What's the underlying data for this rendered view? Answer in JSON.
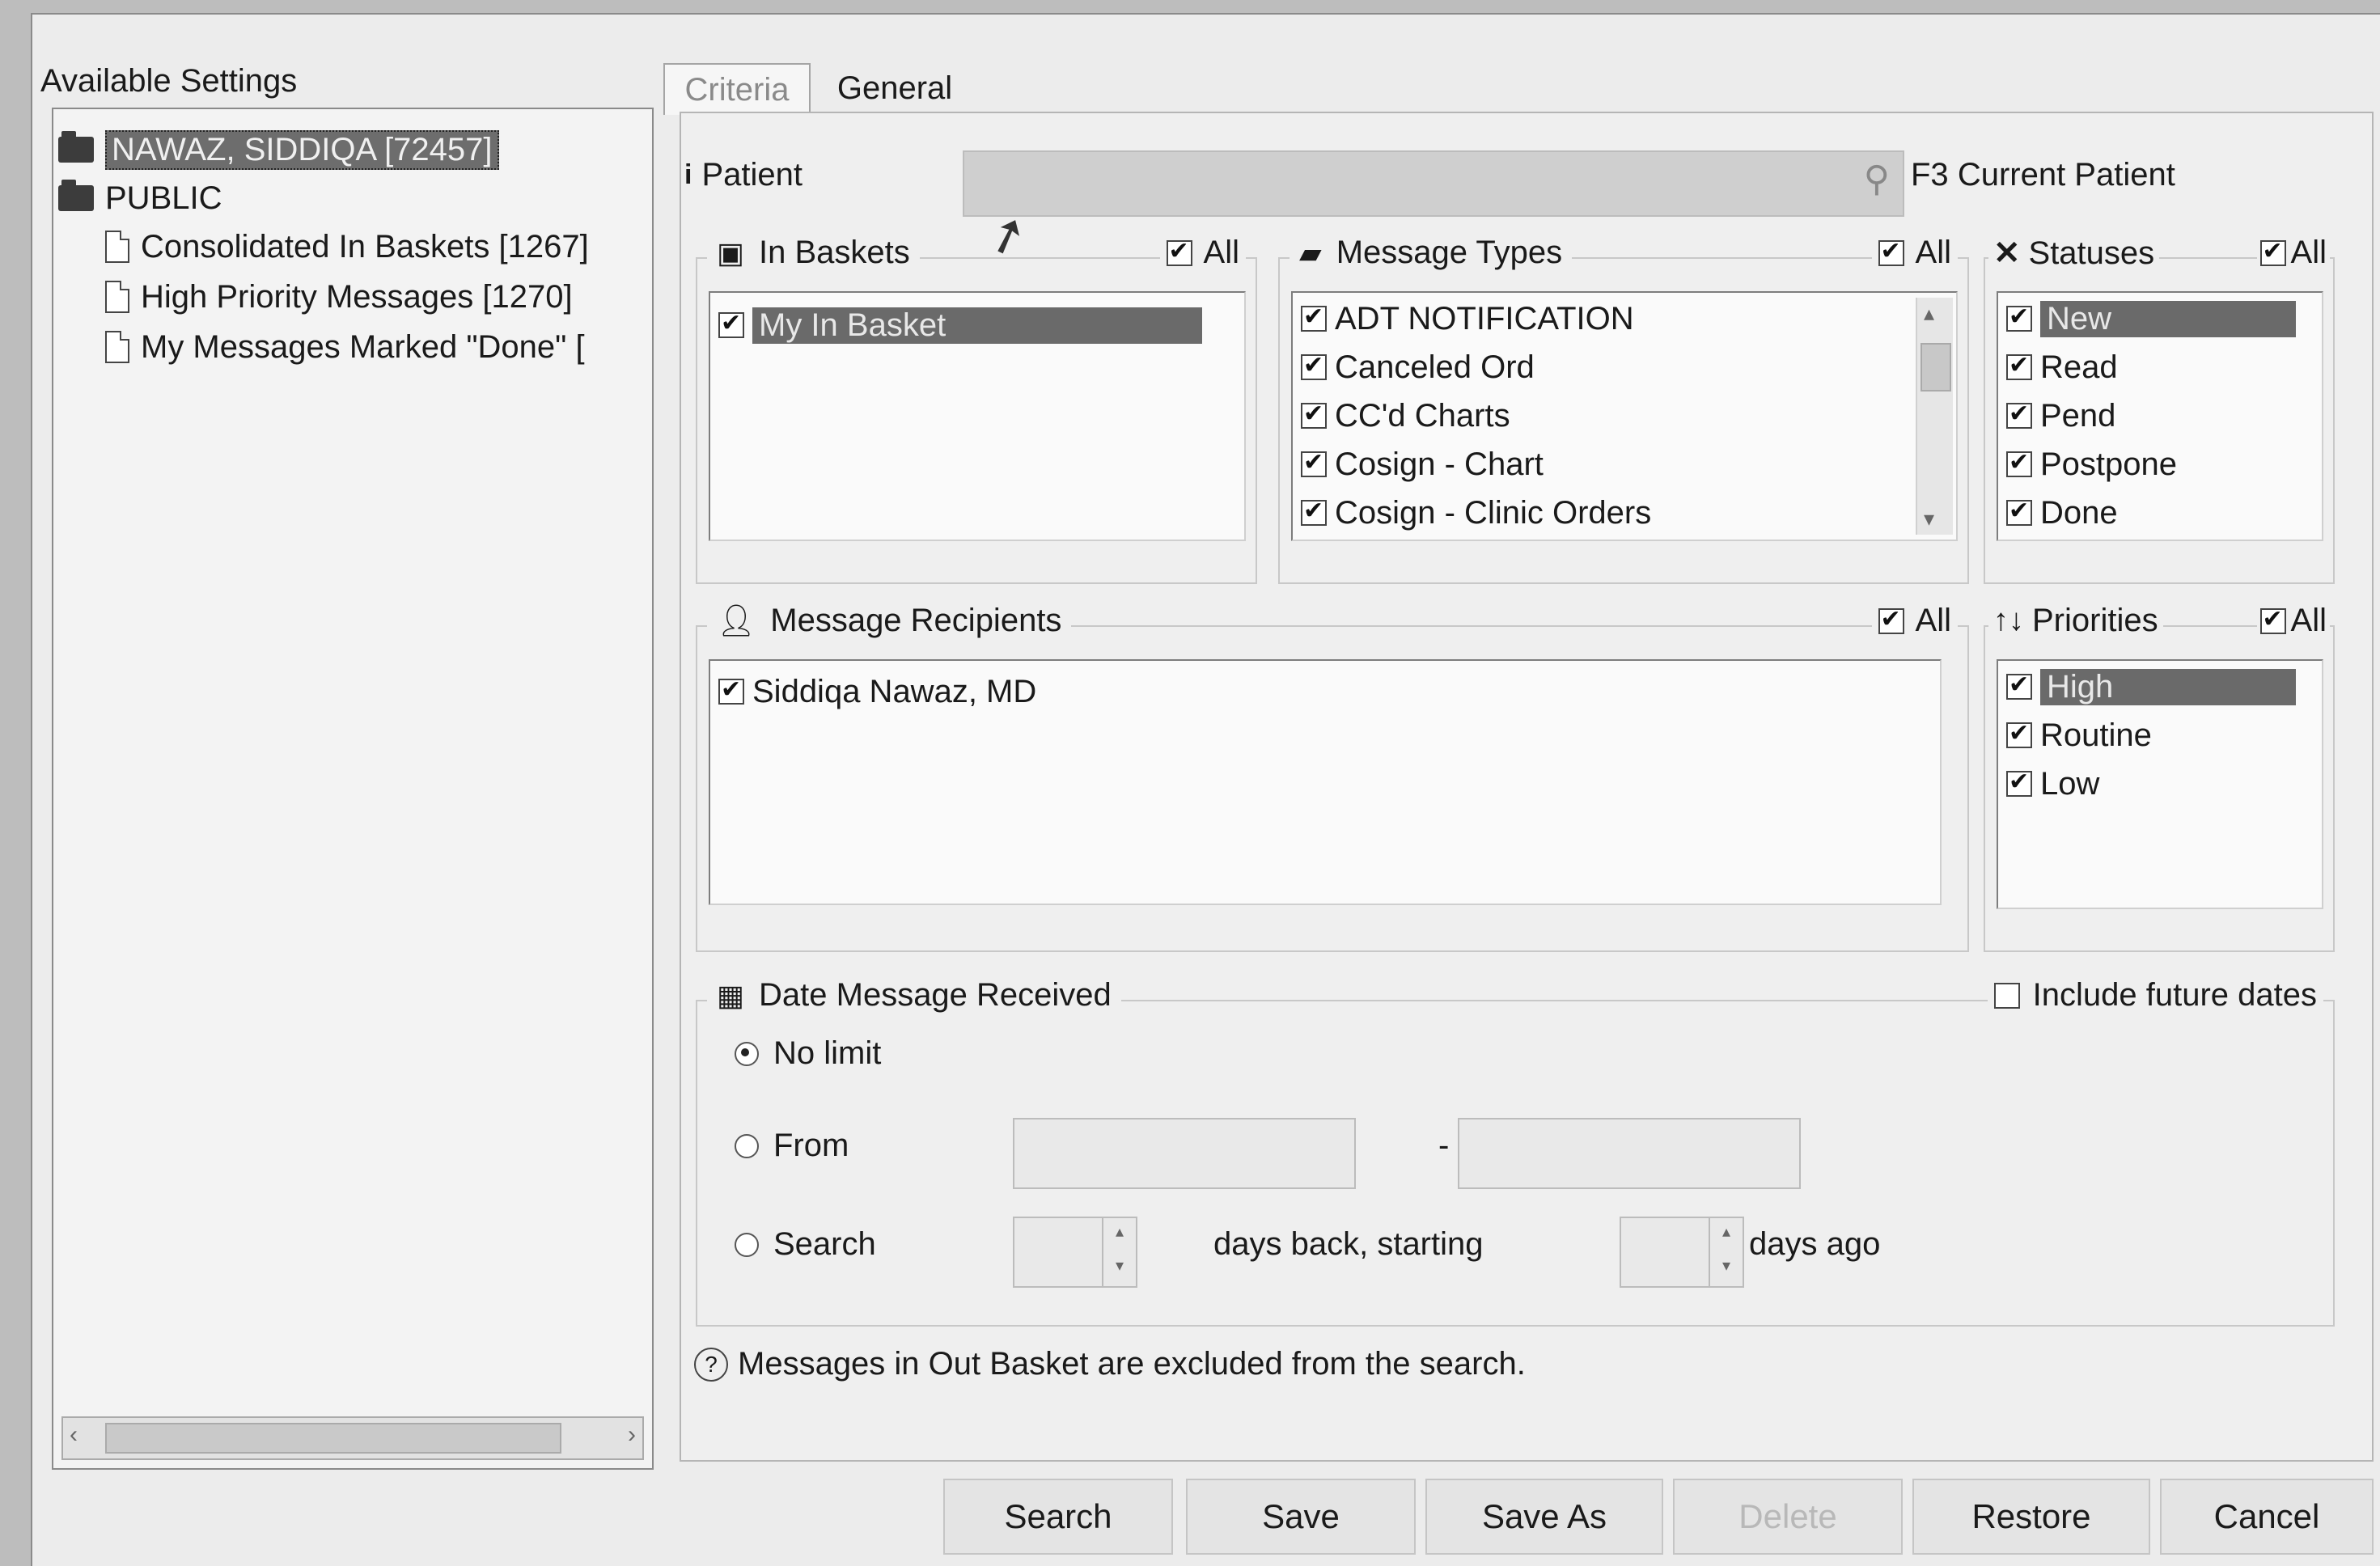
{
  "sidebar": {
    "title": "Available Settings",
    "user_node": "NAWAZ, SIDDIQA [72457]",
    "public_node": "PUBLIC",
    "items": [
      {
        "label": "Consolidated In Baskets [1267]"
      },
      {
        "label": "High Priority Messages [1270]"
      },
      {
        "label": "My Messages Marked \"Done\" ["
      }
    ]
  },
  "tabs": [
    {
      "label": "Criteria"
    },
    {
      "label": "General"
    }
  ],
  "patient": {
    "label": "Patient",
    "value": "",
    "shortcut": "F3",
    "shortcut_label": "Current Patient"
  },
  "in_baskets": {
    "title": "In Baskets",
    "all_label": "All",
    "items": [
      {
        "label": "My In Basket",
        "checked": true
      }
    ]
  },
  "message_types": {
    "title": "Message Types",
    "all_label": "All",
    "items": [
      {
        "label": "ADT NOTIFICATION",
        "checked": true
      },
      {
        "label": "Canceled Ord",
        "checked": true
      },
      {
        "label": "CC'd Charts",
        "checked": true
      },
      {
        "label": "Cosign - Chart",
        "checked": true
      },
      {
        "label": "Cosign - Clinic Orders",
        "checked": true
      }
    ]
  },
  "statuses": {
    "title": "Statuses",
    "all_label": "All",
    "items": [
      {
        "label": "New",
        "checked": true
      },
      {
        "label": "Read",
        "checked": true
      },
      {
        "label": "Pend",
        "checked": true
      },
      {
        "label": "Postpone",
        "checked": true
      },
      {
        "label": "Done",
        "checked": true
      }
    ]
  },
  "recipients": {
    "title": "Message Recipients",
    "all_label": "All",
    "items": [
      {
        "label": "Siddiqa Nawaz, MD",
        "checked": true
      }
    ]
  },
  "priorities": {
    "title": "Priorities",
    "all_label": "All",
    "items": [
      {
        "label": "High",
        "checked": true
      },
      {
        "label": "Routine",
        "checked": true
      },
      {
        "label": "Low",
        "checked": true
      }
    ]
  },
  "date": {
    "title": "Date Message Received",
    "include_future_label": "Include future dates",
    "no_limit_label": "No limit",
    "from_label": "From",
    "dash": "-",
    "search_label": "Search",
    "days_back_label": "days back, starting",
    "days_ago_label": "days ago"
  },
  "note": "Messages in Out Basket are excluded from the search.",
  "buttons": {
    "search": "Search",
    "save": "Save",
    "save_as": "Save As",
    "delete": "Delete",
    "restore": "Restore",
    "cancel": "Cancel"
  }
}
